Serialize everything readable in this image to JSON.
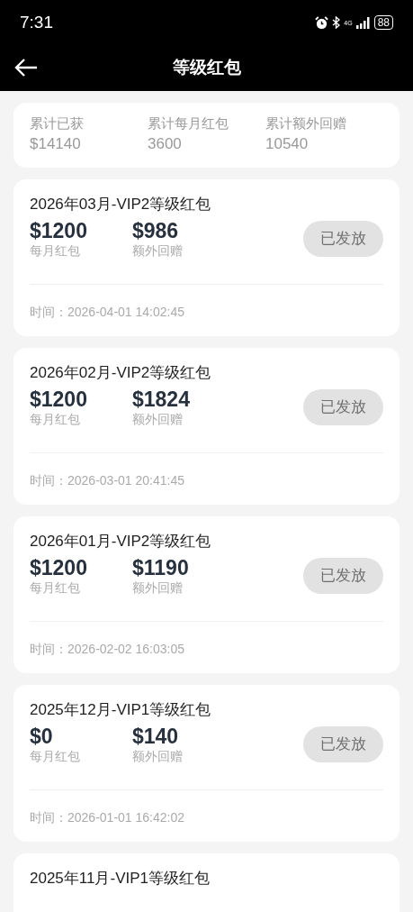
{
  "status_bar": {
    "time": "7:31",
    "network": "4G",
    "battery": "88"
  },
  "header": {
    "title": "等级红包"
  },
  "summary": [
    {
      "label": "累计已获",
      "value": "$14140"
    },
    {
      "label": "累计每月红包",
      "value": "3600"
    },
    {
      "label": "累计额外回赠",
      "value": "10540"
    }
  ],
  "records": [
    {
      "title": "2026年03月-VIP2等级红包",
      "monthly": "$1200",
      "monthly_label": "每月红包",
      "extra": "$986",
      "extra_label": "额外回赠",
      "button": "已发放",
      "disabled": true,
      "time": "时间：2026-04-01 14:02:45"
    },
    {
      "title": "2026年02月-VIP2等级红包",
      "monthly": "$1200",
      "monthly_label": "每月红包",
      "extra": "$1824",
      "extra_label": "额外回赠",
      "button": "已发放",
      "disabled": true,
      "time": "时间：2026-03-01 20:41:45"
    },
    {
      "title": "2026年01月-VIP2等级红包",
      "monthly": "$1200",
      "monthly_label": "每月红包",
      "extra": "$1190",
      "extra_label": "额外回赠",
      "button": "已发放",
      "disabled": true,
      "time": "时间：2026-02-02 16:03:05"
    },
    {
      "title": "2025年12月-VIP1等级红包",
      "monthly": "$0",
      "monthly_label": "每月红包",
      "extra": "$140",
      "extra_label": "额外回赠",
      "button": "已发放",
      "disabled": true,
      "time": "时间：2026-01-01 16:42:02"
    },
    {
      "title": "2025年11月-VIP1等级红包"
    }
  ]
}
